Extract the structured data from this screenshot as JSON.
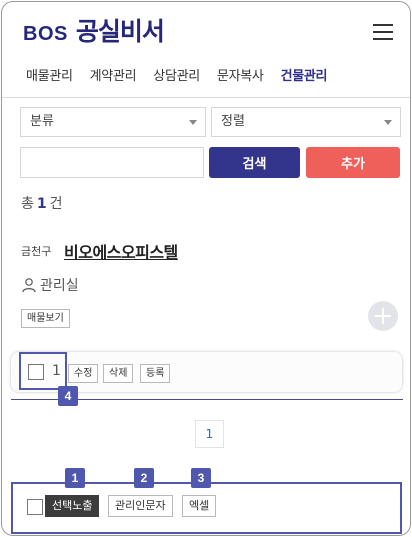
{
  "header": {
    "logo_prefix": "BOS",
    "logo_name": "공실비서",
    "menu_icon": "hamburger-menu-icon"
  },
  "nav": {
    "items": [
      {
        "label": "매물관리",
        "active": false
      },
      {
        "label": "계약관리",
        "active": false
      },
      {
        "label": "상담관리",
        "active": false
      },
      {
        "label": "문자복사",
        "active": false
      },
      {
        "label": "건물관리",
        "active": true
      }
    ]
  },
  "filters": {
    "category": {
      "value": "분류"
    },
    "sort": {
      "value": "정렬"
    }
  },
  "search": {
    "value": "",
    "button_label": "검색",
    "add_label": "추가"
  },
  "total": {
    "prefix": "총",
    "count": "1",
    "suffix": "건"
  },
  "listing": {
    "region": "금천구",
    "name": "비오에스오피스텔",
    "manager_label": "관리실",
    "view_listings_label": "매물보기",
    "manager_icon": "person-icon",
    "add_icon": "plus-icon"
  },
  "card": {
    "number": "1",
    "edit_label": "수정",
    "delete_label": "삭제",
    "register_label": "등록"
  },
  "pagination": {
    "current": "1"
  },
  "bottom_bar": {
    "show_selected_label": "선택노출",
    "manager_sms_label": "관리인문자",
    "excel_label": "엑셀"
  },
  "annotations": {
    "badge1": "1",
    "badge2": "2",
    "badge3": "3",
    "badge4": "4"
  },
  "colors": {
    "brand_navy": "#33358d",
    "add_red": "#f0605a",
    "annotation_blue": "#4f58ad",
    "dark_button": "#3c3c3c"
  }
}
